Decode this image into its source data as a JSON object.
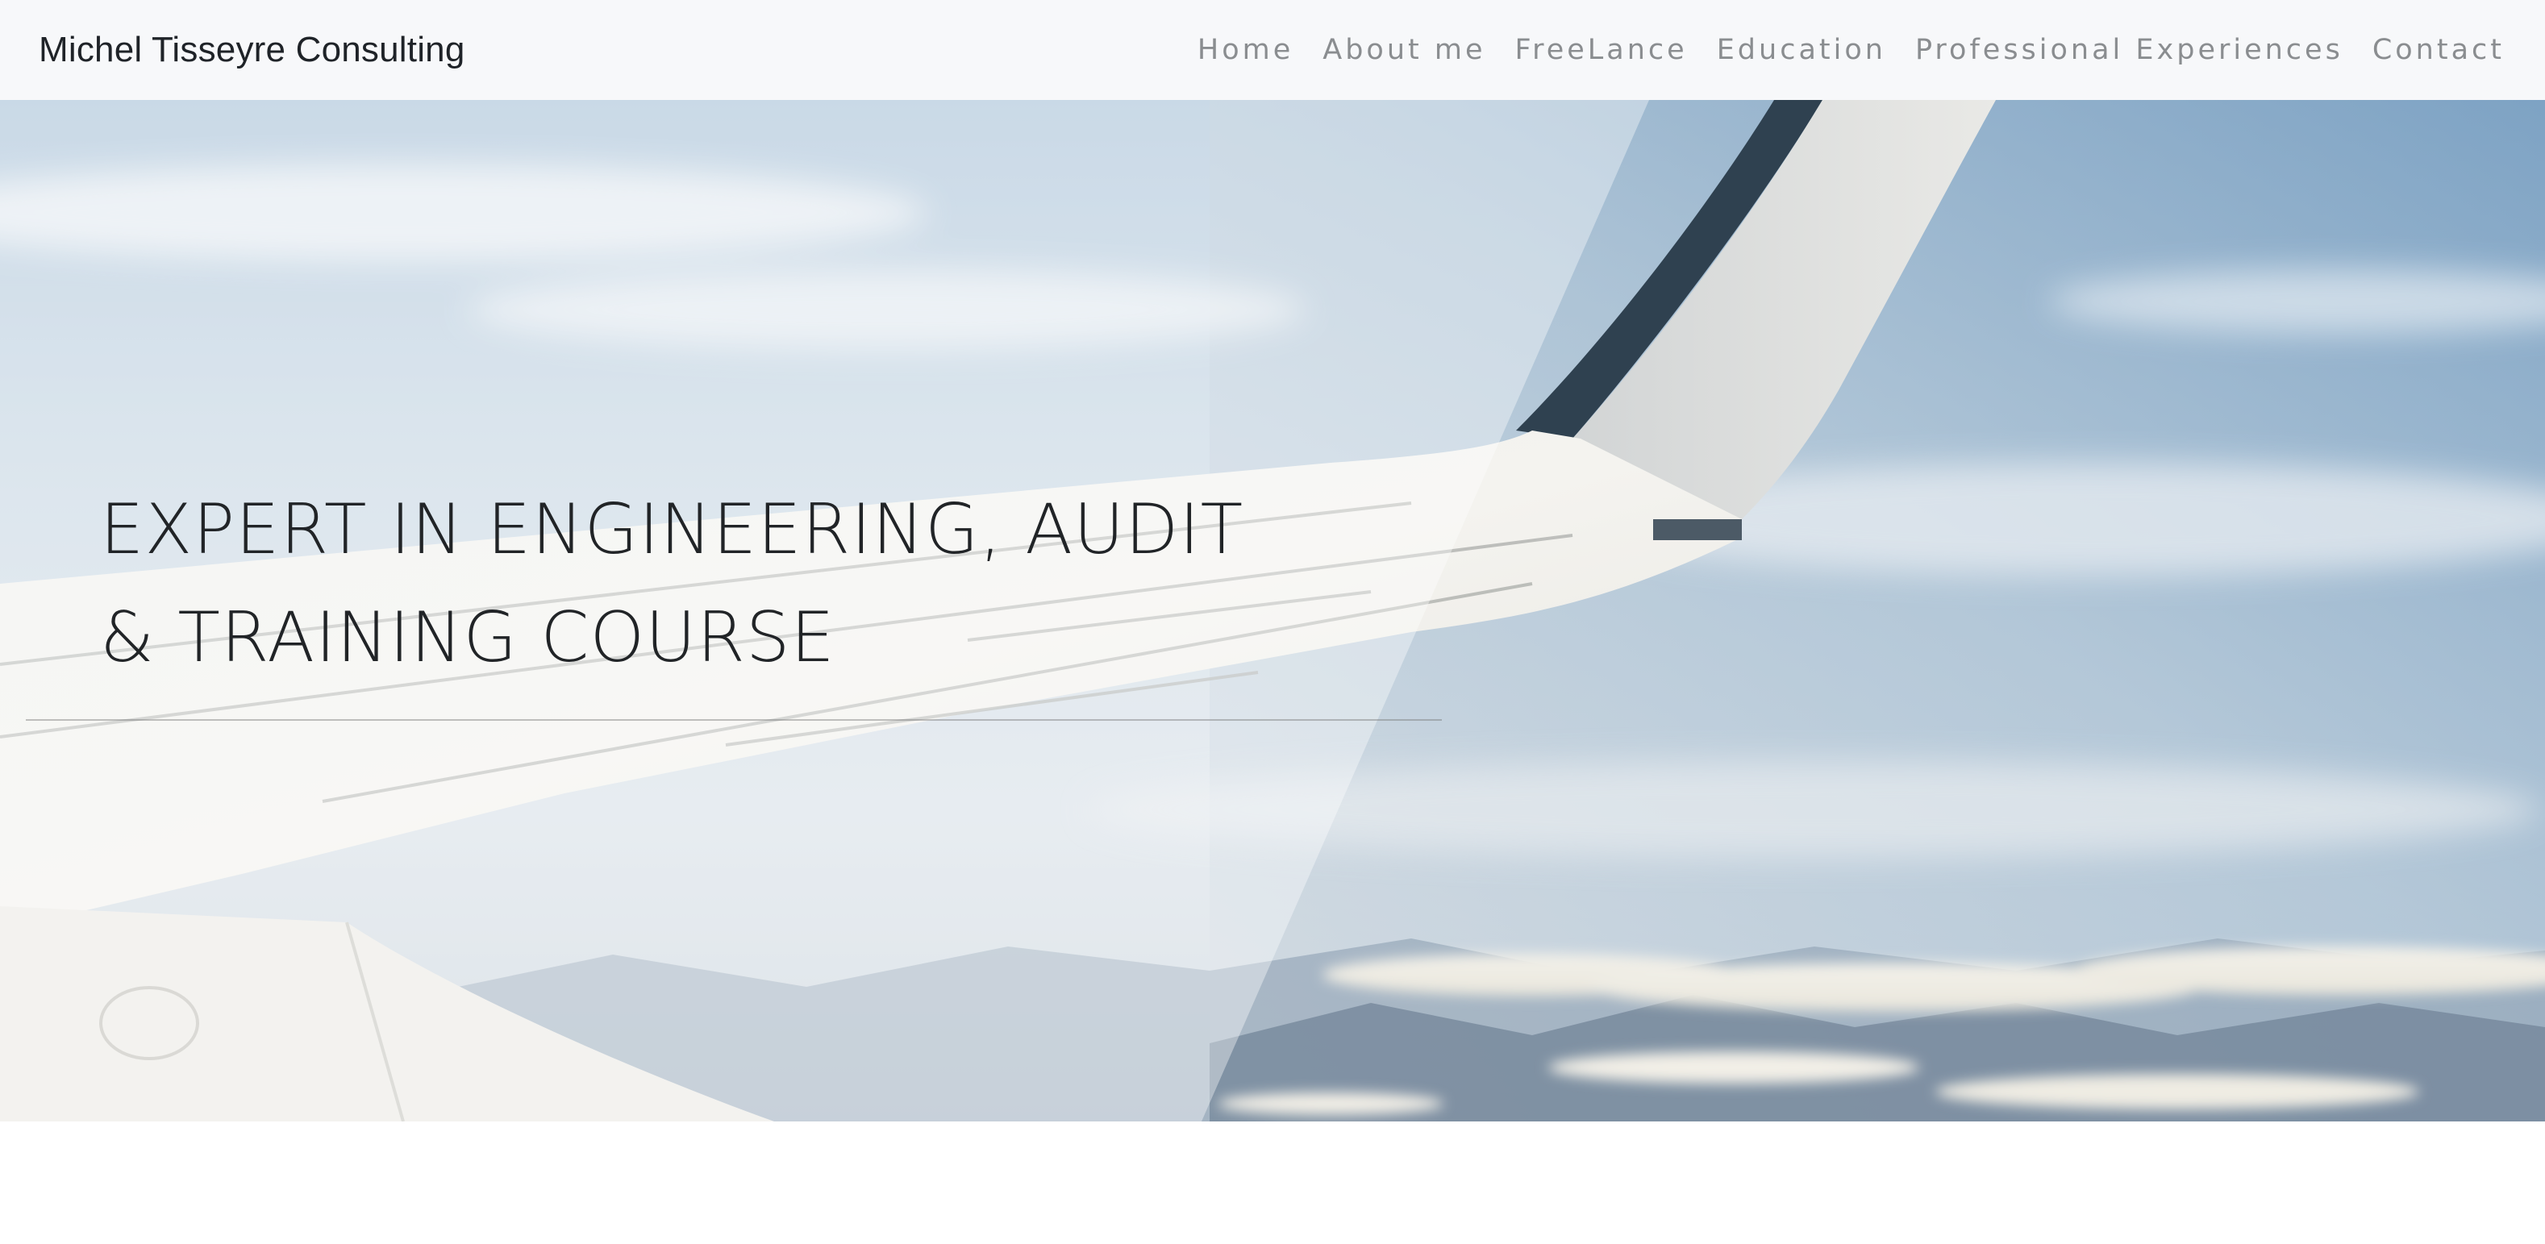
{
  "header": {
    "brand": "Michel Tisseyre Consulting",
    "nav": [
      "Home",
      "About me",
      "FreeLance",
      "Education",
      "Professional Experiences",
      "Contact"
    ]
  },
  "hero": {
    "headline_line1": "EXPERT IN ENGINEERING, AUDIT",
    "headline_line2": "& TRAINING COURSE",
    "background_image": "airplane wing above clouds"
  },
  "colors": {
    "navbar_bg": "#f7f8fa",
    "nav_text": "#8a8d90",
    "headline_text": "#212427"
  }
}
